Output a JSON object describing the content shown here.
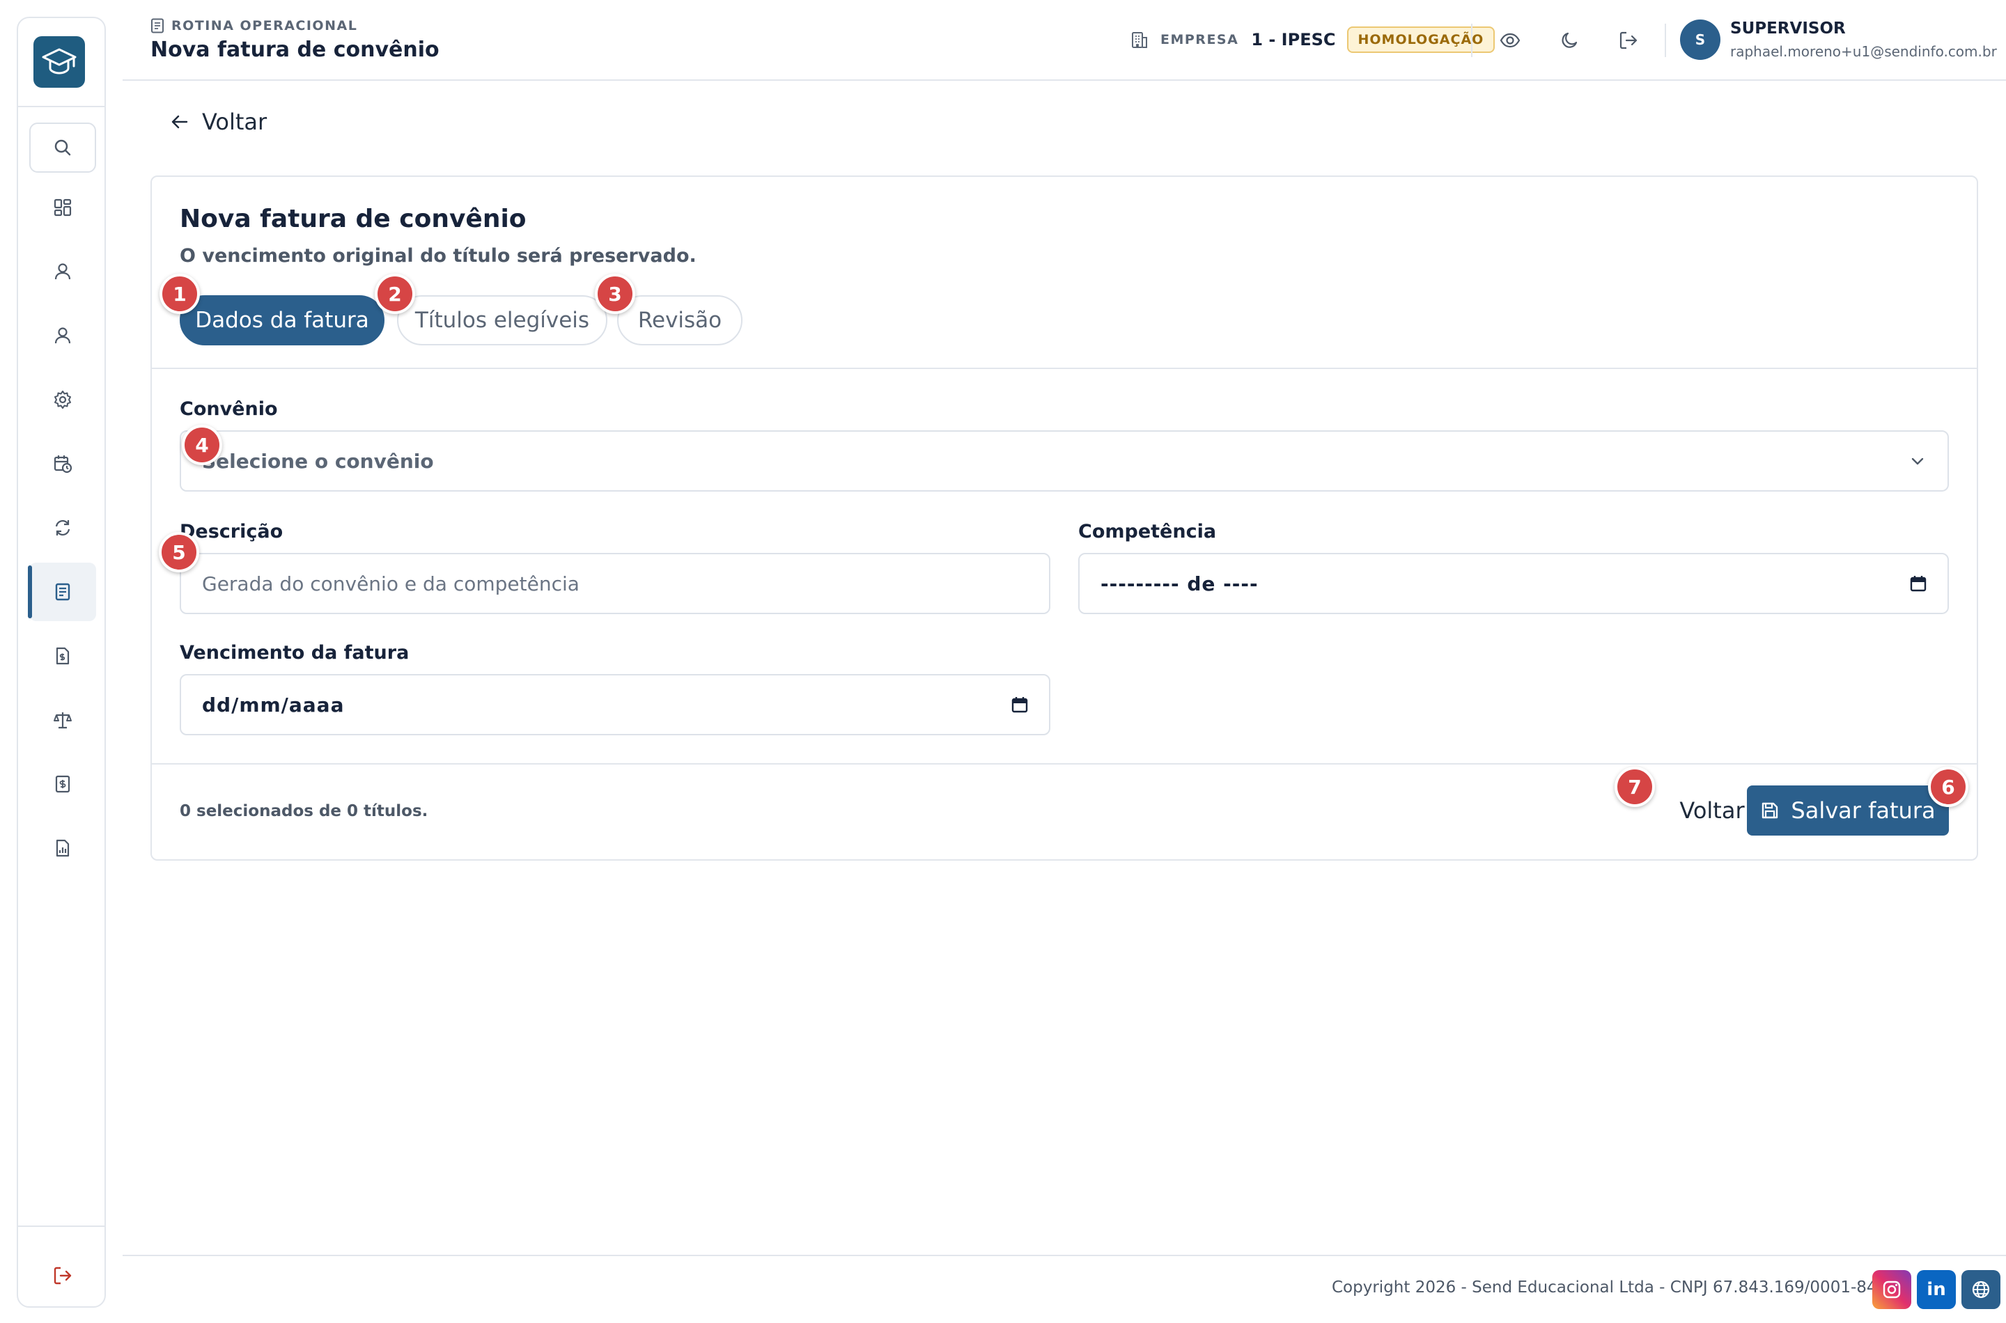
{
  "header": {
    "breadcrumb": "ROTINA OPERACIONAL",
    "title": "Nova fatura de convênio",
    "company_label": "EMPRESA",
    "company_value": "1 - IPESC",
    "environment_badge": "HOMOLOGAÇÃO",
    "user_initial": "S",
    "user_role": "SUPERVISOR",
    "user_email": "raphael.moreno+u1@sendinfo.com.br",
    "icons": [
      "eye-icon",
      "moon-icon",
      "logout-icon"
    ]
  },
  "sidebar": {
    "items": [
      {
        "icon": "dashboard-icon"
      },
      {
        "icon": "user-icon"
      },
      {
        "icon": "user-alt-icon"
      },
      {
        "icon": "gear-icon"
      },
      {
        "icon": "calendar-clock-icon"
      },
      {
        "icon": "refresh-icon"
      },
      {
        "icon": "invoice-icon",
        "active": true
      },
      {
        "icon": "file-dollar-icon"
      },
      {
        "icon": "scale-icon"
      },
      {
        "icon": "receipt-dollar-icon"
      },
      {
        "icon": "report-chart-icon"
      }
    ]
  },
  "back_link": "Voltar",
  "card": {
    "title": "Nova fatura de convênio",
    "subtitle": "O vencimento original do título será preservado.",
    "steps": [
      {
        "label": "Dados da fatura",
        "active": true
      },
      {
        "label": "Títulos elegíveis",
        "active": false
      },
      {
        "label": "Revisão",
        "active": false
      }
    ],
    "fields": {
      "convenio": {
        "label": "Convênio",
        "placeholder": "Selecione o convênio"
      },
      "descricao": {
        "label": "Descrição",
        "placeholder": "Gerada do convênio e da competência"
      },
      "competencia": {
        "label": "Competência",
        "value": "--------- de ----"
      },
      "vencimento": {
        "label": "Vencimento da fatura",
        "value": "dd/mm/aaaa"
      }
    },
    "selected_count": "0 selecionados de 0 títulos.",
    "back_button": "Voltar",
    "save_button": "Salvar fatura"
  },
  "markers": [
    "1",
    "2",
    "3",
    "4",
    "5",
    "6",
    "7"
  ],
  "footer": {
    "copyright": "Copyright 2026 - Send Educacional Ltda - CNPJ 67.843.169/0001-84",
    "linkedin_text": "in"
  },
  "colors": {
    "primary": "#2b5f8c",
    "marker": "#d64545",
    "badge_bg": "#fdf3d6",
    "badge_text": "#9b6a09",
    "logout_red": "#c0392b"
  }
}
